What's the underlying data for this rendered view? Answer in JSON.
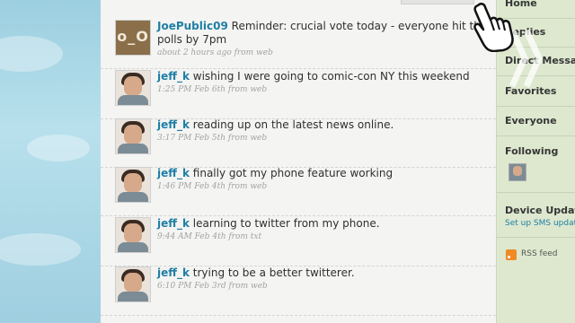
{
  "timeline": {
    "tweets": [
      {
        "user": "JoePublic09",
        "text": "Reminder: crucial vote today - everyone hit the polls by 7pm",
        "meta": "about 2 hours ago from web",
        "avatar": "joe",
        "avatar_text": "o_O"
      },
      {
        "user": "jeff_k",
        "text": "wishing I were going to comic-con NY this weekend",
        "meta": "1:25 PM Feb 6th from web",
        "avatar": "jeff"
      },
      {
        "user": "jeff_k",
        "text": "reading up on the latest news online.",
        "meta": "3:17 PM Feb 5th from web",
        "avatar": "jeff"
      },
      {
        "user": "jeff_k",
        "text": "finally got my phone feature working",
        "meta": "1:46 PM Feb 4th from web",
        "avatar": "jeff"
      },
      {
        "user": "jeff_k",
        "text": "learning to twitter from my phone.",
        "meta": "9:44 AM Feb 4th from txt",
        "avatar": "jeff"
      },
      {
        "user": "jeff_k",
        "text": "trying to be a better twitterer.",
        "meta": "6:10 PM Feb 3rd from web",
        "avatar": "jeff"
      }
    ]
  },
  "sidebar": {
    "nav": [
      "Home",
      "Replies",
      "Direct Messages",
      "Favorites",
      "Everyone"
    ],
    "following_label": "Following",
    "device_label": "Device Updates",
    "device_link": "Set up SMS updates",
    "rss_label": "RSS feed"
  },
  "icons": [
    "hand-pointer-icon",
    "chevron-right-icon",
    "rss-icon"
  ],
  "colors": {
    "link": "#1f7fa4",
    "sidebar_bg": "#dde8cf",
    "timeline_bg": "#f4f4f3",
    "rss": "#f08a24"
  }
}
